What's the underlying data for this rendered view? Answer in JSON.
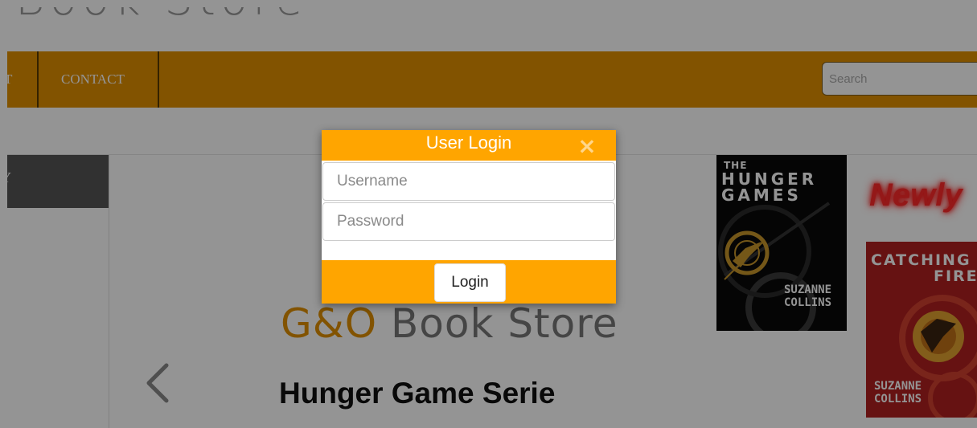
{
  "site": {
    "title": "Book Store"
  },
  "nav": {
    "items": [
      "T",
      "CONTACT"
    ],
    "search_placeholder": "Search"
  },
  "sidebar": {
    "header": "Y"
  },
  "main": {
    "heading_accent": "G&O",
    "heading_rest": " Book Store",
    "carousel_title": "Hunger Game Serie",
    "prev_label": "previous"
  },
  "books": [
    {
      "title_lines": [
        "THE",
        "HUNGER",
        "GAMES"
      ],
      "author_lines": [
        "SUZANNE",
        "COLLINS"
      ]
    },
    {
      "title_lines": [
        "CATCHING",
        "FIRE"
      ],
      "author_lines": [
        "SUZANNE",
        "COLLINS"
      ]
    }
  ],
  "newly_label": "Newly",
  "modal": {
    "title": "User Login",
    "close_glyph": "×",
    "username_placeholder": "Username",
    "password_placeholder": "Password",
    "login_label": "Login"
  },
  "colors": {
    "accent": "#e08f00",
    "modal": "#ffa500",
    "sidebar": "#555555"
  }
}
